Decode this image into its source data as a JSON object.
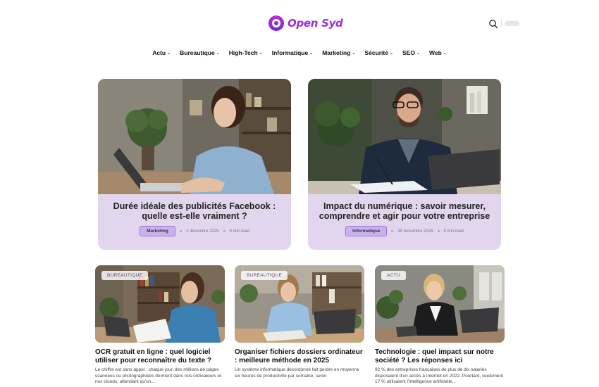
{
  "brand": {
    "name": "Open Syd",
    "accent": "#a02bd8"
  },
  "header": {
    "search_icon": "search-icon"
  },
  "nav": {
    "items": [
      {
        "label": "Actu"
      },
      {
        "label": "Bureautique"
      },
      {
        "label": "High-Tech"
      },
      {
        "label": "Informatique"
      },
      {
        "label": "Marketing"
      },
      {
        "label": "Sécurité"
      },
      {
        "label": "SEO"
      },
      {
        "label": "Web"
      }
    ]
  },
  "featured": [
    {
      "title": "Durée idéale des publicités Facebook : quelle est-elle vraiment ?",
      "category": "Marketing",
      "date": "1 décembre 2025",
      "read": "9 min read"
    },
    {
      "title": "Impact du numérique : savoir mesurer, comprendre et agir pour votre entreprise",
      "category": "Informatique",
      "date": "29 novembre 2025",
      "read": "9 min read"
    }
  ],
  "cards": [
    {
      "tag": "BUREAUTIQUE",
      "title": "OCR gratuit en ligne : quel logiciel utiliser pour reconnaître du texte ?",
      "excerpt": "Le chiffre est sans appel : chaque jour, des millions de pages scannées ou photographiées dorment dans nos ordinateurs et nos clouds, attendant qu'un..."
    },
    {
      "tag": "BUREAUTIQUE",
      "title": "Organiser fichiers dossiers ordinateur : meilleure méthode en 2025",
      "excerpt": "Un système informatique désordonné fait perdre en moyenne six heures de productivité par semaine, selon"
    },
    {
      "tag": "ACTU",
      "title": "Technologie : quel impact sur notre société ? Les réponses ici",
      "excerpt": "92 % des entreprises françaises de plus de dix salariés disposaient d'un accès à Internet en 2022. Pourtant, seulement 17 % utilisaient l'intelligence artificielle..."
    }
  ]
}
